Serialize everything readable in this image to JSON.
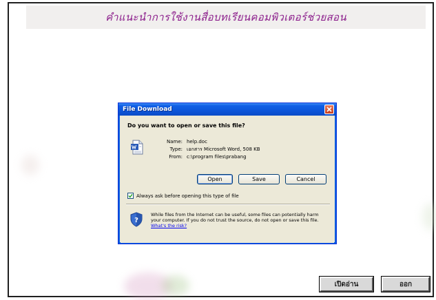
{
  "page": {
    "header_title": "คำแนะนำการใช้งานสื่อบทเรียนคอมพิวเตอร์ช่วยสอน",
    "buttons": {
      "open_read": "เปิดอ่าน",
      "exit": "ออก"
    }
  },
  "dialog": {
    "title": "File Download",
    "question": "Do you want to open or save this file?",
    "file_info": {
      "name_label": "Name:",
      "name_value": "help.doc",
      "type_label": "Type:",
      "type_value": "เอกสาร Microsoft Word, 508 KB",
      "from_label": "From:",
      "from_value": "c:\\program files\\prabang"
    },
    "buttons": {
      "open": "Open",
      "save": "Save",
      "cancel": "Cancel"
    },
    "checkbox": {
      "label": "Always ask before opening this type of file",
      "checked": true
    },
    "warning": {
      "text": "While files from the Internet can be useful, some files can potentially harm your computer. If you do not trust the source, do not open or save this file.",
      "link": "What's the risk?"
    },
    "icons": {
      "file": "word-document-icon",
      "shield": "security-shield-icon",
      "close": "close-icon"
    }
  },
  "colors": {
    "title_accent": "#8c1f8c",
    "xp_title_blue": "#0c55d9",
    "xp_close_red": "#c8401d",
    "dialog_face": "#ece9d8"
  }
}
